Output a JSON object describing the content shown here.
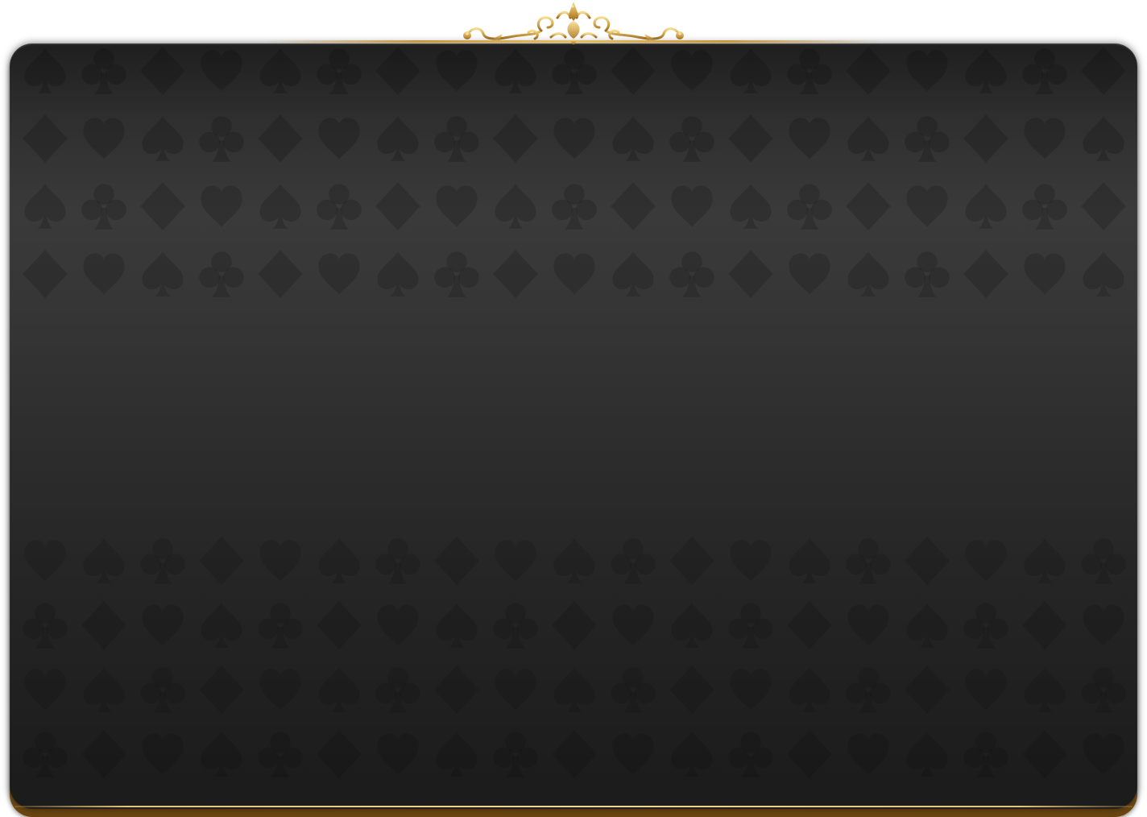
{
  "screen": {
    "name": "card-table-board"
  },
  "board": {
    "background_color": "#2b2b2b",
    "pattern_icons": [
      "spade-icon",
      "heart-icon",
      "diamond-icon",
      "club-icon"
    ],
    "trim_color": "#d4a64a",
    "rim_color": "#7a5417"
  },
  "crest": {
    "icon": "ornamental-crest-icon",
    "color": "#d4a64a"
  }
}
